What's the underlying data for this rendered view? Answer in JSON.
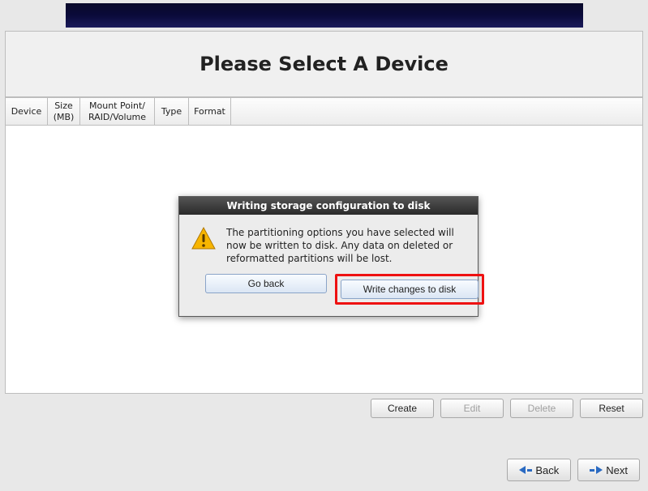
{
  "header": {
    "title": "Please Select A Device"
  },
  "table": {
    "columns": {
      "device": "Device",
      "size": "Size\n(MB)",
      "mount": "Mount Point/\nRAID/Volume",
      "type": "Type",
      "format": "Format"
    }
  },
  "actions": {
    "create": "Create",
    "edit": "Edit",
    "delete": "Delete",
    "reset": "Reset"
  },
  "nav": {
    "back": "Back",
    "next": "Next"
  },
  "dialog": {
    "title": "Writing storage configuration to disk",
    "message": "The partitioning options you have selected will now be written to disk.  Any data on deleted or reformatted partitions will be lost.",
    "go_back": "Go back",
    "write": "Write changes to disk"
  }
}
